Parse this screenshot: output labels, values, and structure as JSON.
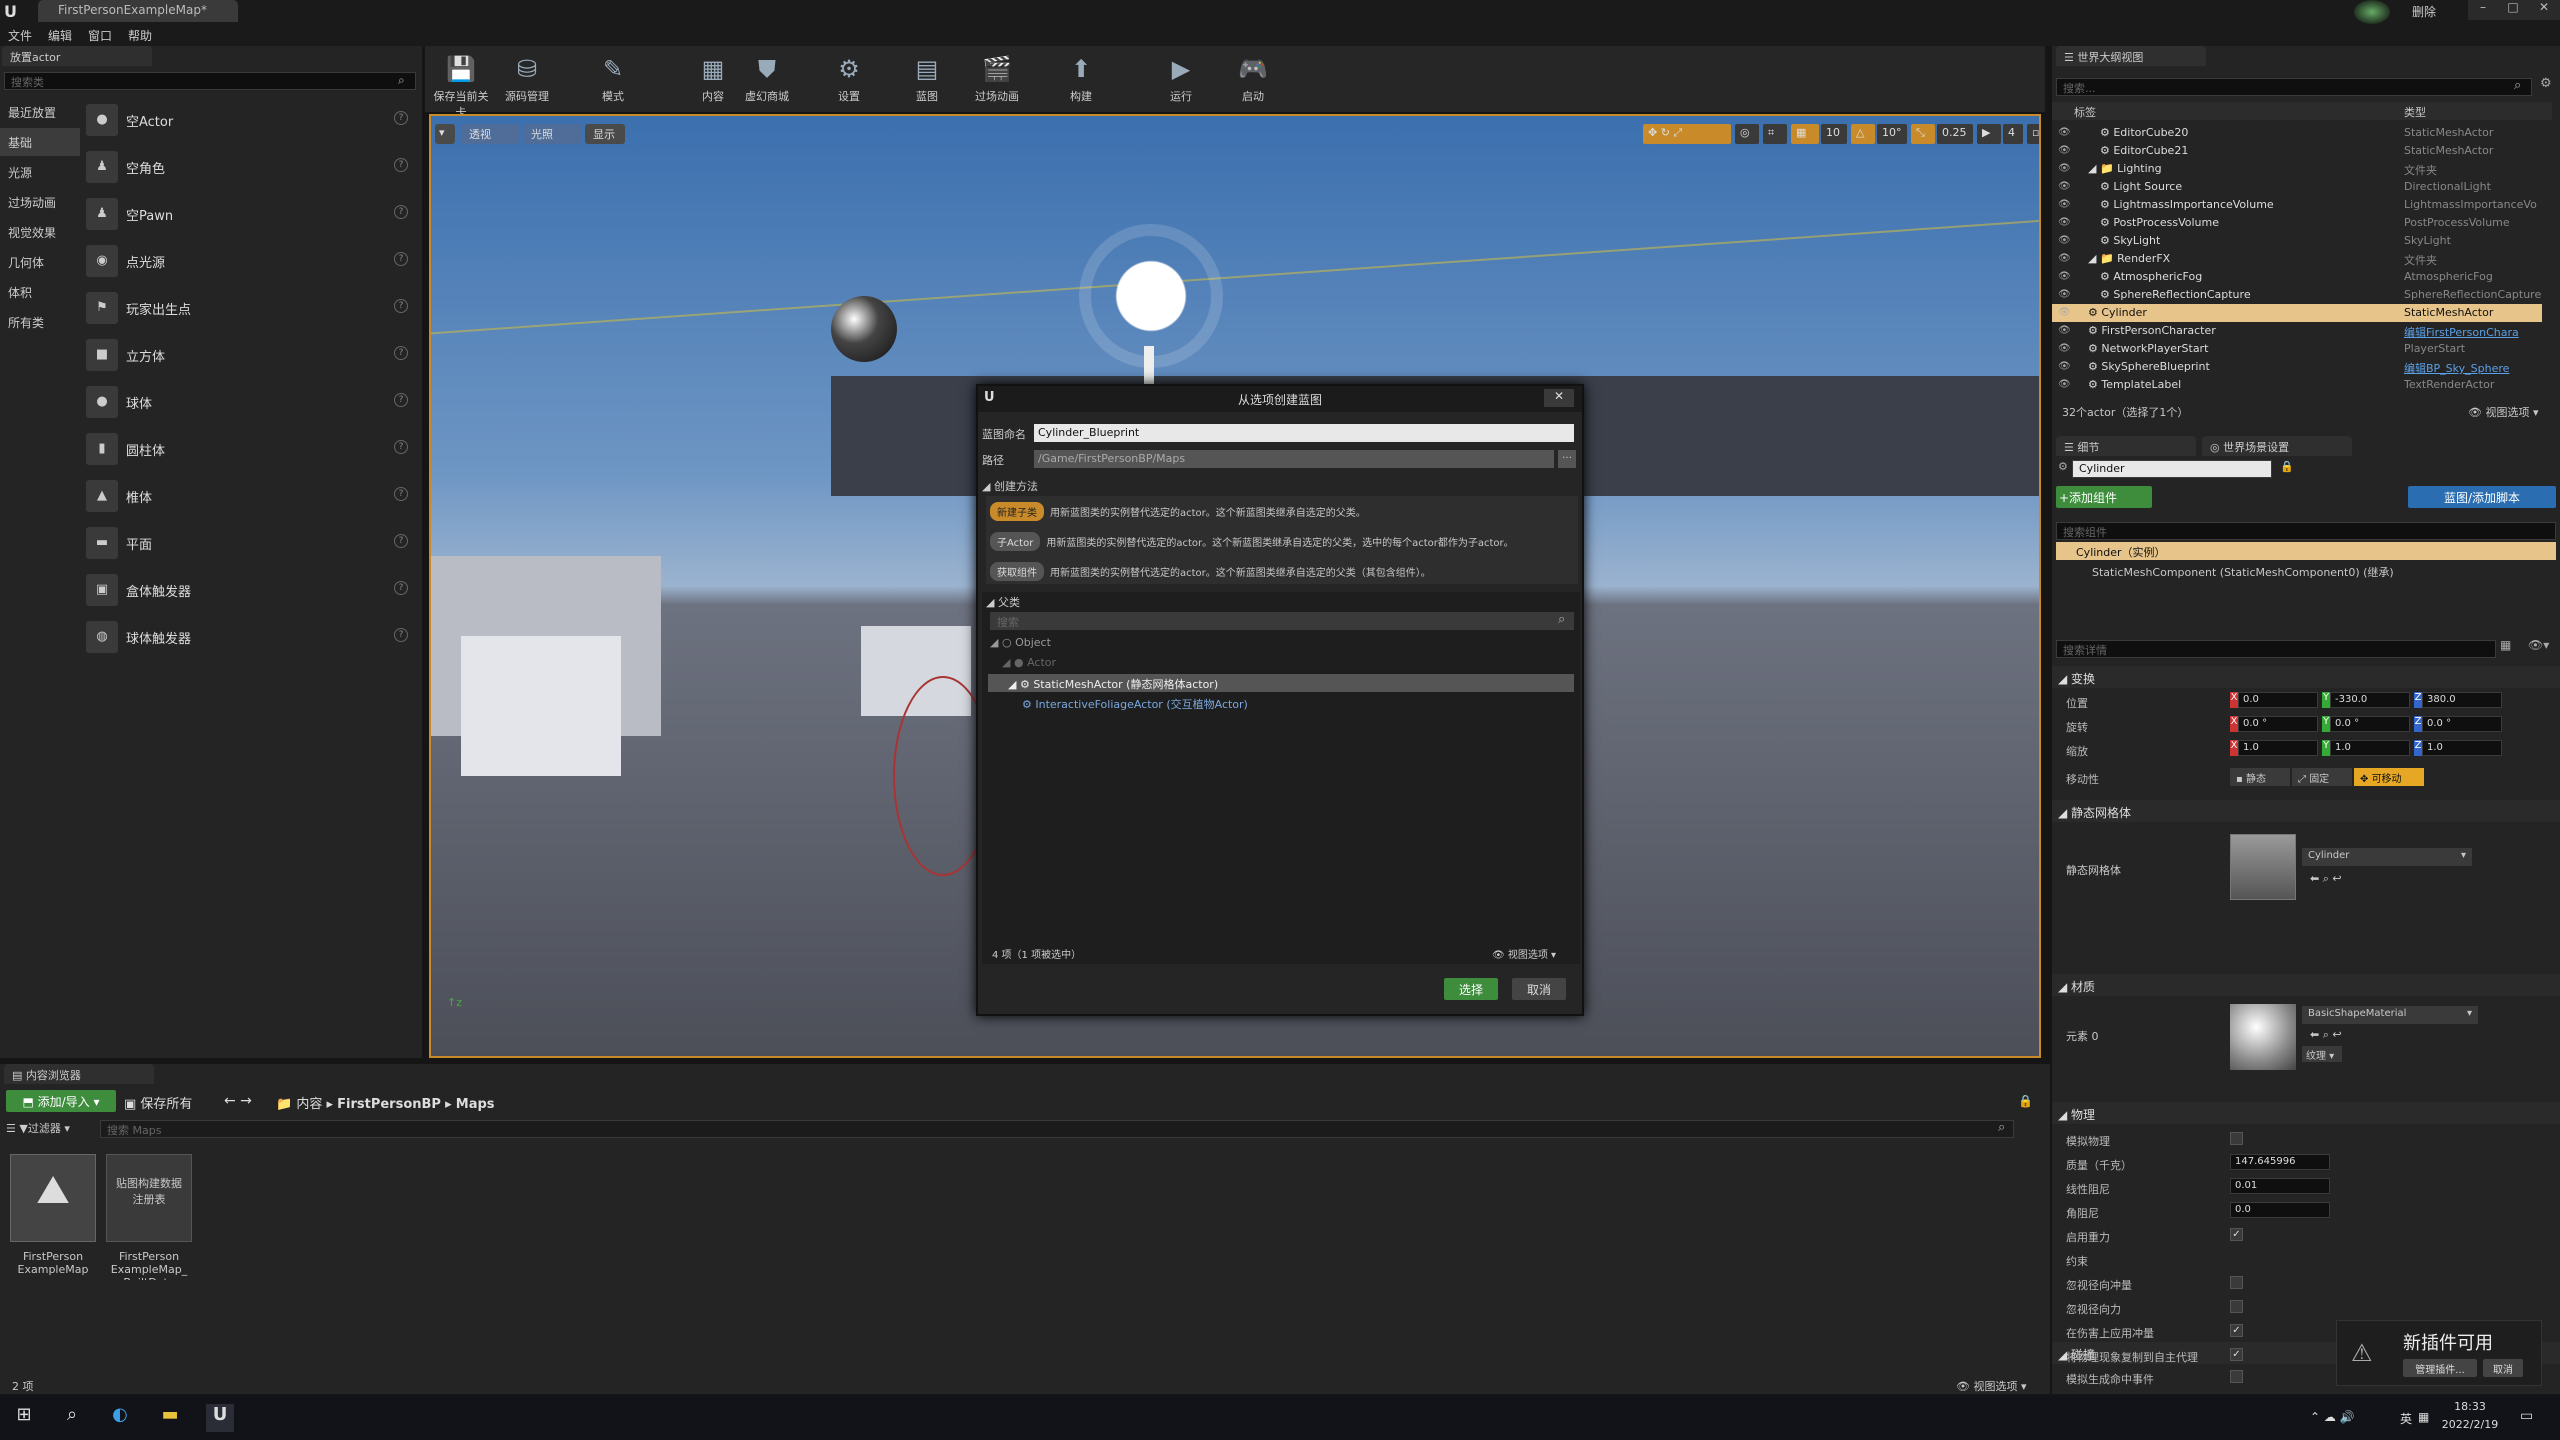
{
  "window": {
    "doc_tab": "FirstPersonExampleMap*",
    "top_right_label": "删除"
  },
  "menu": [
    "文件",
    "编辑",
    "窗口",
    "帮助"
  ],
  "place_actor": {
    "tab": "放置actor",
    "search_placeholder": "搜索类",
    "categories": [
      "最近放置",
      "基础",
      "光源",
      "过场动画",
      "视觉效果",
      "几何体",
      "体积",
      "所有类"
    ],
    "items": [
      "空Actor",
      "空角色",
      "空Pawn",
      "点光源",
      "玩家出生点",
      "立方体",
      "球体",
      "圆柱体",
      "椎体",
      "平面",
      "盒体触发器",
      "球体触发器"
    ]
  },
  "toolbar": [
    "保存当前关卡",
    "源码管理",
    "模式",
    "内容",
    "虚幻商城",
    "设置",
    "蓝图",
    "过场动画",
    "构建",
    "运行",
    "启动"
  ],
  "viewport": {
    "buttons": [
      "透视",
      "光照",
      "显示"
    ],
    "grid_values": [
      "10",
      "10°",
      "0.25",
      "4"
    ]
  },
  "dialog": {
    "title": "从选项创建蓝图",
    "name_label": "蓝图命名",
    "name_value": "Cylinder_Blueprint",
    "path_label": "路径",
    "path_value": "/Game/FirstPersonBP/Maps",
    "method_header": "创建方法",
    "methods": [
      {
        "pill": "新建子类",
        "desc": "用新蓝图类的实例替代选定的actor。这个新蓝图类继承自选定的父类。"
      },
      {
        "pill": "子Actor",
        "desc": "用新蓝图类的实例替代选定的actor。这个新蓝图类继承自选定的父类，选中的每个actor都作为子actor。"
      },
      {
        "pill": "获取组件",
        "desc": "用新蓝图类的实例替代选定的actor。这个新蓝图类继承自选定的父类（其包含组件）。"
      }
    ],
    "parent_header": "父类",
    "search_placeholder": "搜索",
    "tree": [
      "Object",
      "Actor",
      "StaticMeshActor (静态网格体actor)",
      "InteractiveFoliageActor (交互植物Actor)"
    ],
    "status": "4 项（1 项被选中）",
    "view_options": "视图选项",
    "select_btn": "选择",
    "cancel_btn": "取消"
  },
  "outliner": {
    "tab": "世界大纲视图",
    "search_placeholder": "搜索...",
    "col_label": "标签",
    "col_type": "类型",
    "rows": [
      {
        "name": "EditorCube20",
        "type": "StaticMeshActor",
        "indent": 2
      },
      {
        "name": "EditorCube21",
        "type": "StaticMeshActor",
        "indent": 2
      },
      {
        "name": "Lighting",
        "type": "文件夹",
        "indent": 1
      },
      {
        "name": "Light Source",
        "type": "DirectionalLight",
        "indent": 2
      },
      {
        "name": "LightmassImportanceVolume",
        "type": "LightmassImportanceVo",
        "indent": 2
      },
      {
        "name": "PostProcessVolume",
        "type": "PostProcessVolume",
        "indent": 2
      },
      {
        "name": "SkyLight",
        "type": "SkyLight",
        "indent": 2
      },
      {
        "name": "RenderFX",
        "type": "文件夹",
        "indent": 1
      },
      {
        "name": "AtmosphericFog",
        "type": "AtmosphericFog",
        "indent": 2
      },
      {
        "name": "SphereReflectionCapture",
        "type": "SphereReflectionCapture",
        "indent": 2
      },
      {
        "name": "Cylinder",
        "type": "StaticMeshActor",
        "indent": 1
      },
      {
        "name": "FirstPersonCharacter",
        "type": "编辑FirstPersonChara",
        "indent": 1
      },
      {
        "name": "NetworkPlayerStart",
        "type": "PlayerStart",
        "indent": 1
      },
      {
        "name": "SkySphereBlueprint",
        "type": "编辑BP_Sky_Sphere",
        "indent": 1
      },
      {
        "name": "TemplateLabel",
        "type": "TextRenderActor",
        "indent": 1
      }
    ],
    "selected_index": 10,
    "status": "32个actor（选择了1个）",
    "view_options": "视图选项"
  },
  "details": {
    "tab": "细节",
    "tab2": "世界场景设置",
    "actor_name": "Cylinder",
    "add_component": "+添加组件",
    "blueprint_btn": "蓝图/添加脚本",
    "search_components": "搜索组件",
    "component_root": "Cylinder（实例）",
    "component_child": "StaticMeshComponent (StaticMeshComponent0) (继承)",
    "search_details": "搜索详情",
    "transform": "变换",
    "location_label": "位置",
    "location": [
      "0.0",
      "-330.0",
      "380.0"
    ],
    "rotation_label": "旋转",
    "rotation": [
      "0.0 °",
      "0.0 °",
      "0.0 °"
    ],
    "scale_label": "缩放",
    "scale": [
      "1.0",
      "1.0",
      "1.0"
    ],
    "mobility_label": "移动性",
    "mobility": [
      "静态",
      "固定",
      "可移动"
    ],
    "static_mesh_section": "静态网格体",
    "static_mesh_label": "静态网格体",
    "static_mesh_value": "Cylinder",
    "materials_section": "材质",
    "element_label": "元素 0",
    "material_value": "BasicShapeMaterial",
    "texture_btn": "纹理",
    "physics_section": "物理",
    "physics_rows": [
      {
        "label": "模拟物理",
        "kind": "check",
        "value": false
      },
      {
        "label": "质量（千克）",
        "kind": "num",
        "value": "147.645996"
      },
      {
        "label": "线性阻尼",
        "kind": "num",
        "value": "0.01"
      },
      {
        "label": "角阻尼",
        "kind": "num",
        "value": "0.0"
      },
      {
        "label": "启用重力",
        "kind": "check",
        "value": true
      },
      {
        "label": "约束",
        "kind": "header",
        "value": ""
      },
      {
        "label": "忽视径向冲量",
        "kind": "check",
        "value": false
      },
      {
        "label": "忽视径向力",
        "kind": "check",
        "value": false
      },
      {
        "label": "在伤害上应用冲量",
        "kind": "check",
        "value": true
      },
      {
        "label": "将物理现象复制到自主代理",
        "kind": "check",
        "value": true
      }
    ],
    "collision_section": "碰撞",
    "collision_row": "模拟生成命中事件"
  },
  "content_browser": {
    "tab": "内容浏览器",
    "add_import": "添加/导入",
    "save_all": "保存所有",
    "breadcrumb": [
      "内容",
      "FirstPersonBP",
      "Maps"
    ],
    "filters": "过滤器",
    "search_placeholder": "搜索 Maps",
    "assets": [
      {
        "label": "FirstPerson ExampleMap",
        "thumb_text": ""
      },
      {
        "label": "FirstPerson ExampleMap_ BuiltData",
        "thumb_text": "贴图构建数据注册表"
      }
    ],
    "count": "2 项",
    "view_options": "视图选项"
  },
  "toast": {
    "title": "新插件可用",
    "manage": "管理插件...",
    "cancel": "取消"
  },
  "taskbar": {
    "time": "18:33",
    "date": "2022/2/19",
    "ime": "英"
  }
}
